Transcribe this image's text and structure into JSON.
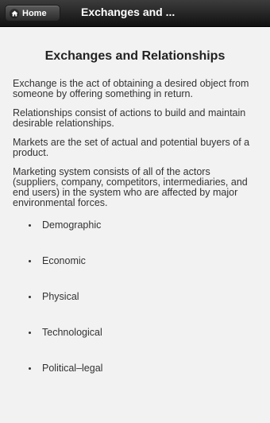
{
  "header": {
    "home_label": "Home",
    "title": "Exchanges and ..."
  },
  "content": {
    "title": "Exchanges and Relationships",
    "paragraphs": [
      "Exchange is the act of obtaining a desired object from someone by offering something in return.",
      "Relationships consist of actions to build and maintain desirable relationships.",
      "Markets are the set of actual and potential buyers of a product.",
      "Marketing system consists of all of the actors (suppliers, company, competitors, intermediaries, and end users) in the system who are affected by major environmental forces."
    ],
    "bullets": [
      "Demographic",
      "Economic",
      "Physical",
      "Technological",
      "Political–legal"
    ]
  }
}
